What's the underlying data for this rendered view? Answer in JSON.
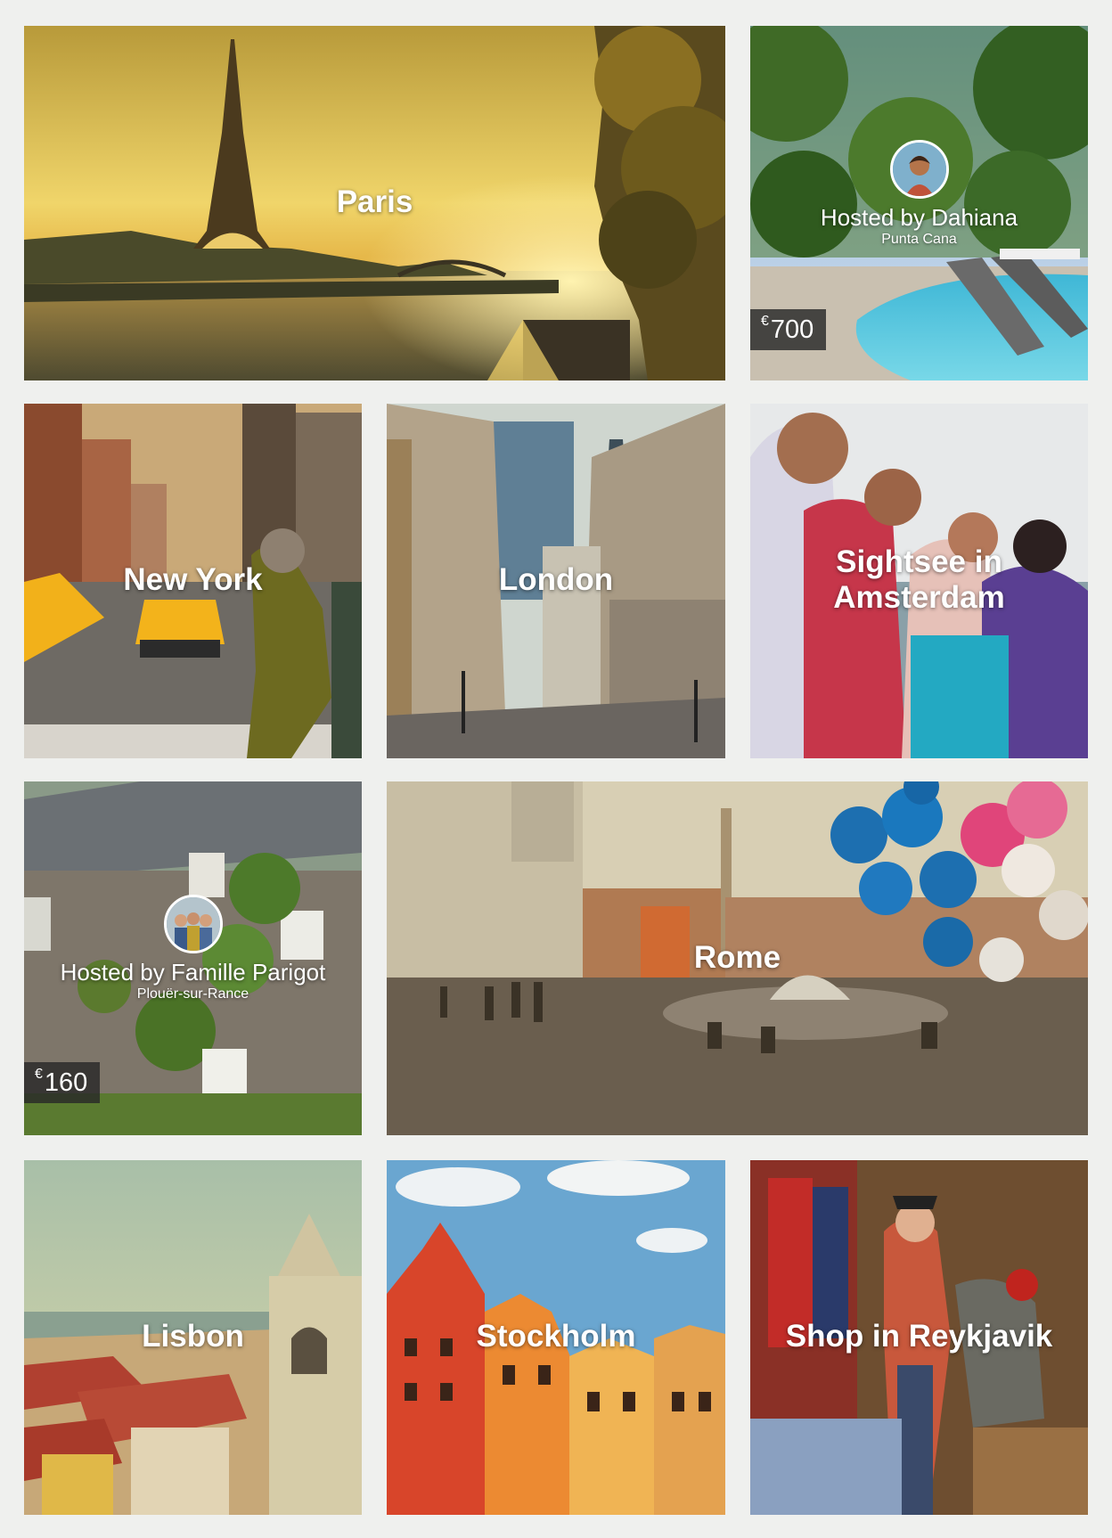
{
  "tiles": {
    "paris": {
      "title": "Paris"
    },
    "dahiana": {
      "host_name": "Hosted by Dahiana",
      "location": "Punta Cana",
      "currency": "€",
      "price": "700"
    },
    "new_york": {
      "title": "New York"
    },
    "london": {
      "title": "London"
    },
    "amsterdam": {
      "title": "Sightsee in Amsterdam"
    },
    "parigot": {
      "host_name": "Hosted by Famille Parigot",
      "location": "Plouër-sur-Rance",
      "currency": "€",
      "price": "160"
    },
    "rome": {
      "title": "Rome"
    },
    "lisbon": {
      "title": "Lisbon"
    },
    "stockholm": {
      "title": "Stockholm"
    },
    "reykjavik": {
      "title": "Shop in Reykjavik"
    }
  },
  "colors": {
    "page_background": "#eff0ee",
    "price_badge": "#282828",
    "text": "#ffffff"
  }
}
